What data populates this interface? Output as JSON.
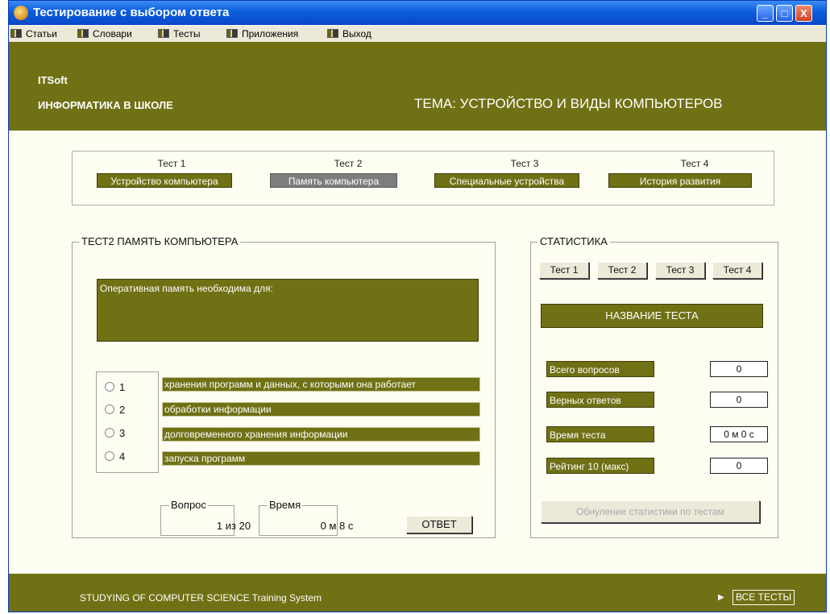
{
  "window": {
    "title": "Тестирование с выбором ответа",
    "controls": [
      "_",
      "□",
      "X"
    ]
  },
  "menu": [
    "Статьи",
    "Словари",
    "Тесты",
    "Приложения",
    "Выход"
  ],
  "header": {
    "brand": "ITSoft",
    "subtitle": "ИНФОРМАТИКА В ШКОЛЕ",
    "theme": "ТЕМА: УСТРОЙСТВО И ВИДЫ КОМПЬЮТЕРОВ"
  },
  "tests": [
    {
      "caption": "Тест 1",
      "label": "Устройство компьютера",
      "selected": false
    },
    {
      "caption": "Тест 2",
      "label": "Память компьютера",
      "selected": true
    },
    {
      "caption": "Тест 3",
      "label": "Специальные устройства",
      "selected": false
    },
    {
      "caption": "Тест 4",
      "label": "История развития",
      "selected": false
    }
  ],
  "test_panel": {
    "legend": "ТЕСТ2 ПАМЯТЬ КОМПЬЮТЕРА",
    "question": "Оперативная память необходима для:",
    "options": [
      {
        "number": "1",
        "text": "хранения программ и данных, с которыми она работает"
      },
      {
        "number": "2",
        "text": "обработки информации"
      },
      {
        "number": "3",
        "text": "долговременного хранения информации"
      },
      {
        "number": "4",
        "text": "запуска программ"
      }
    ],
    "question_counter": {
      "label": "Вопрос",
      "value": "1 из 20"
    },
    "timer": {
      "label": "Время",
      "value": "0 м 8 с"
    },
    "answer_button": "ОТВЕТ"
  },
  "stats": {
    "legend": "СТАТИСТИКА",
    "tabs": [
      "Тест 1",
      "Тест 2",
      "Тест 3",
      "Тест 4"
    ],
    "test_name": "НАЗВАНИЕ ТЕСТА",
    "rows": [
      {
        "label": "Всего вопросов",
        "value": "0"
      },
      {
        "label": "Верных ответов",
        "value": "0"
      },
      {
        "label": "Время теста",
        "value": "0 м 0 с"
      },
      {
        "label": "Рейтинг 10 (макс)",
        "value": "0"
      }
    ],
    "reset_button": "Обнуление статистики по тестам"
  },
  "footer": {
    "text": "STUDYING OF COMPUTER SCIENCE Training System",
    "arrow": "▶",
    "all_tests": "ВСЕ ТЕСТЫ"
  },
  "colors": {
    "olive": "#707015",
    "background": "#fefdf1",
    "titlebar": "#0a5ddc"
  }
}
